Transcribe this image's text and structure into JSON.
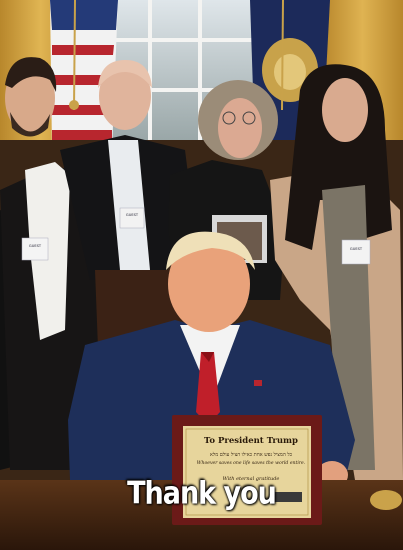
{
  "caption": "Thank you",
  "plaque": {
    "title": "To President Trump",
    "hebrew": "כל המציל נפש אחת כאילו הציל עולם מלא",
    "quote": "Whoever saves one life saves the world entire.",
    "sign": "With eternal gratitude"
  },
  "badges": [
    "GUEST",
    "GUEST",
    "GUEST",
    "GUEST"
  ],
  "colors": {
    "curtain": "#c89a3a",
    "navy_suit": "#1e2f5a",
    "tie": "#c01f2a",
    "plaque_frame": "#6b1a18",
    "plaque_face": "#e7d59c"
  }
}
